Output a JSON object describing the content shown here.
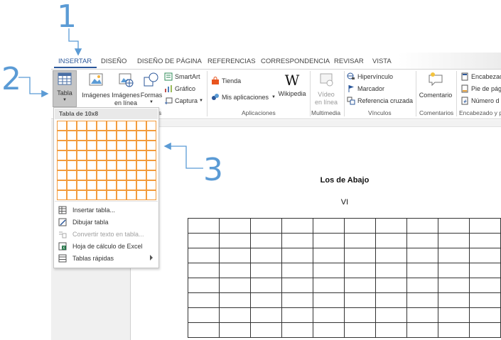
{
  "annotations": [
    "1",
    "2",
    "3"
  ],
  "tabs": [
    "INSERTAR",
    "DISEÑO",
    "DISEÑO DE PÁGINA",
    "REFERENCIAS",
    "CORRESPONDENCIA",
    "REVISAR",
    "VISTA"
  ],
  "ribbon": {
    "tabla": "Tabla",
    "imagenes": "Imágenes",
    "imagenes_en_linea_1": "Imágenes",
    "imagenes_en_linea_2": "en línea",
    "formas": "Formas",
    "smartart": "SmartArt",
    "grafico": "Gráfico",
    "captura": "Captura",
    "tienda": "Tienda",
    "mis_aplicaciones": "Mis aplicaciones",
    "wikipedia": "Wikipedia",
    "video_1": "Vídeo",
    "video_2": "en línea",
    "hipervinculo": "Hipervínculo",
    "marcador": "Marcador",
    "referencia_cruzada": "Referencia cruzada",
    "comentario": "Comentario",
    "encabezado": "Encabezad",
    "pie_de_pagina": "Pie de pág",
    "numero_de": "Número d",
    "groups": {
      "ilustraciones_tail": "s",
      "aplicaciones": "Aplicaciones",
      "multimedia": "Multimedia",
      "vinculos": "Vínculos",
      "comentarios": "Comentarios",
      "encabezado_y_pie": "Encabezado y pi"
    }
  },
  "dropdown": {
    "header": "Tabla de 10x8",
    "grid": {
      "columns": 10,
      "rows": 8
    },
    "items": [
      {
        "label": "Insertar tabla...",
        "icon": "insert-table-icon",
        "disabled": false
      },
      {
        "label": "Dibujar tabla",
        "icon": "draw-table-icon",
        "disabled": false
      },
      {
        "label": "Convertir texto en tabla...",
        "icon": "convert-text-icon",
        "disabled": true
      },
      {
        "label": "Hoja de cálculo de Excel",
        "icon": "excel-icon",
        "disabled": false
      },
      {
        "label": "Tablas rápidas",
        "icon": "quick-tables-icon",
        "disabled": false,
        "submenu": true
      }
    ]
  },
  "document": {
    "title": "Los de Abajo",
    "subtitle": "VI",
    "table": {
      "columns": 10,
      "rows": 8
    }
  },
  "colors": {
    "accent": "#2b579a",
    "annotation": "#5b9bd5",
    "grid_cell": "#f39c3d"
  }
}
